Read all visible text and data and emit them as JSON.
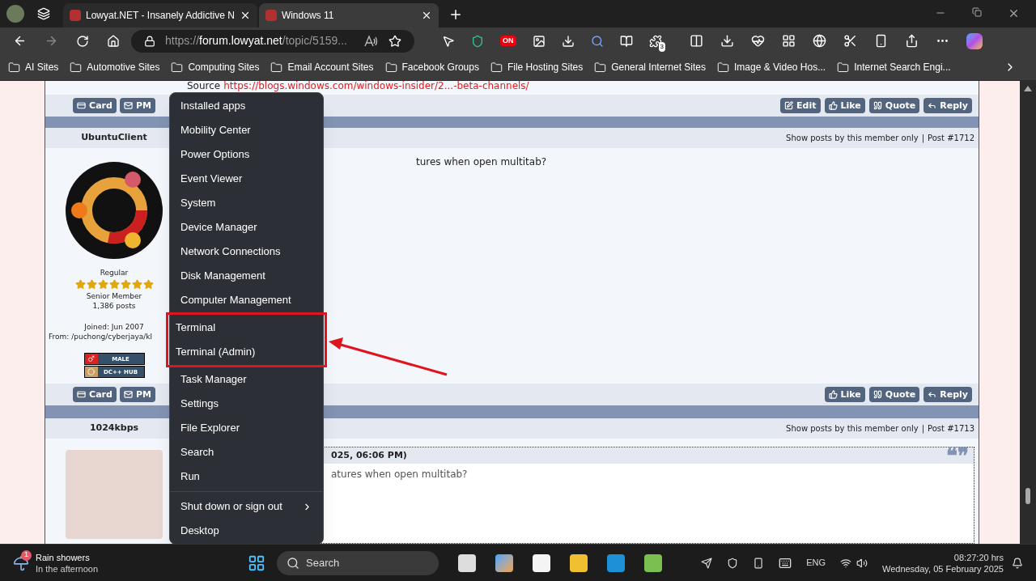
{
  "browser": {
    "tabs": [
      {
        "title": "Lowyat.NET - Insanely Addictive N",
        "selected": false
      },
      {
        "title": "Windows 11",
        "selected": true
      }
    ],
    "address": {
      "scheme": "https://",
      "host": "forum.lowyat.net",
      "path": "/topic/5159..."
    },
    "extension_badge": "3",
    "toggle_label": "ON",
    "bookmarks": [
      "AI Sites",
      "Automotive Sites",
      "Computing Sites",
      "Email Account Sites",
      "Facebook Groups",
      "File Hosting Sites",
      "General Internet Sites",
      "Image & Video Hos...",
      "Internet Search Engi..."
    ]
  },
  "forum": {
    "source": {
      "label": "Source",
      "link": "https://blogs.windows.com/windows-insider/2...-beta-channels/"
    },
    "top_actions": {
      "left": [
        {
          "kind": "card",
          "label": "Card"
        },
        {
          "kind": "pm",
          "label": "PM"
        }
      ],
      "right": [
        {
          "kind": "edit",
          "label": "Edit"
        },
        {
          "kind": "like",
          "label": "Like"
        },
        {
          "kind": "quote",
          "label": "Quote"
        },
        {
          "kind": "reply",
          "label": "Reply"
        }
      ]
    },
    "posts": [
      {
        "author": "UbuntuClient",
        "filter_link": "Show posts by this member only",
        "separator": "|",
        "post_number": "Post #1712",
        "profile": {
          "group": "Regular",
          "stars": 7,
          "rank": "Senior Member",
          "posts": "1,386 posts",
          "joined": "Joined: Jun 2007",
          "from": "From: /puchong/cyberjaya/kl",
          "badges": [
            {
              "kind": "gender",
              "label": "MALE"
            },
            {
              "kind": "hub",
              "label": "DC++ HUB"
            }
          ]
        },
        "body": "tures when open multitab?",
        "actions": {
          "left": [
            {
              "kind": "card",
              "label": "Card"
            },
            {
              "kind": "pm",
              "label": "PM"
            }
          ],
          "right": [
            {
              "kind": "like",
              "label": "Like"
            },
            {
              "kind": "quote",
              "label": "Quote"
            },
            {
              "kind": "reply",
              "label": "Reply"
            }
          ]
        }
      },
      {
        "author": "1024kbps",
        "filter_link": "Show posts by this member only",
        "separator": "|",
        "post_number": "Post #1713",
        "quote": {
          "header": "025, 06:06 PM)",
          "marks": "❝❞",
          "text": "atures when open multitab?"
        }
      }
    ]
  },
  "context_menu": {
    "items": [
      {
        "label": "Installed apps",
        "kind": "item",
        "highlighted": false
      },
      {
        "label": "Mobility Center",
        "kind": "item",
        "highlighted": false
      },
      {
        "label": "Power Options",
        "kind": "item",
        "highlighted": false
      },
      {
        "label": "Event Viewer",
        "kind": "item",
        "highlighted": false
      },
      {
        "label": "System",
        "kind": "item",
        "highlighted": false
      },
      {
        "label": "Device Manager",
        "kind": "item",
        "highlighted": false
      },
      {
        "label": "Network Connections",
        "kind": "item",
        "highlighted": false
      },
      {
        "label": "Disk Management",
        "kind": "item",
        "highlighted": false
      },
      {
        "label": "Computer Management",
        "kind": "item",
        "highlighted": false
      },
      {
        "label": "Terminal",
        "kind": "item",
        "highlighted": true
      },
      {
        "label": "Terminal (Admin)",
        "kind": "item",
        "highlighted": true
      },
      {
        "label": "Task Manager",
        "kind": "item",
        "highlighted": false
      },
      {
        "label": "Settings",
        "kind": "item",
        "highlighted": false
      },
      {
        "label": "File Explorer",
        "kind": "item",
        "highlighted": false
      },
      {
        "label": "Search",
        "kind": "item",
        "highlighted": false
      },
      {
        "label": "Run",
        "kind": "item",
        "highlighted": false
      },
      {
        "label": "Shut down or sign out",
        "kind": "submenu",
        "highlighted": false
      },
      {
        "label": "Desktop",
        "kind": "item",
        "highlighted": false
      }
    ]
  },
  "taskbar": {
    "weather": {
      "badge": "1",
      "title": "Rain showers",
      "subtitle": "In the afternoon"
    },
    "search": {
      "placeholder": "Search"
    },
    "language": "ENG",
    "time": "08:27:20 hrs",
    "date": "Wednesday, 05 February 2025"
  }
}
